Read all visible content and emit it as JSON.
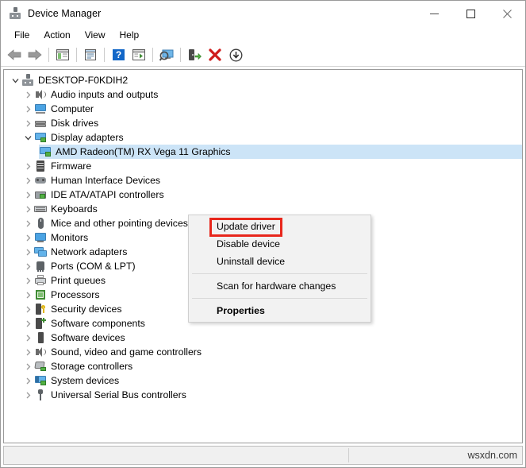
{
  "window": {
    "title": "Device Manager",
    "icon": "device-manager-icon",
    "controls": {
      "minimize": "minimize-icon",
      "maximize": "maximize-icon",
      "close": "close-icon"
    }
  },
  "menubar": {
    "items": [
      {
        "label": "File"
      },
      {
        "label": "Action"
      },
      {
        "label": "View"
      },
      {
        "label": "Help"
      }
    ]
  },
  "toolbar": {
    "buttons": [
      {
        "name": "back-icon",
        "title": "Back"
      },
      {
        "name": "forward-icon",
        "title": "Forward"
      },
      {
        "name": "show-hide-console-tree-icon",
        "title": "Show/Hide console tree"
      },
      {
        "name": "properties-icon",
        "title": "Properties"
      },
      {
        "name": "help-icon",
        "title": "Help"
      },
      {
        "name": "scan-for-hardware-changes-icon",
        "title": "Scan for hardware changes"
      },
      {
        "name": "update-driver-icon",
        "title": "Update driver"
      },
      {
        "name": "uninstall-device-icon",
        "title": "Uninstall device"
      },
      {
        "name": "disable-device-icon",
        "title": "Disable device"
      },
      {
        "name": "enable-device-icon",
        "title": "Enable device"
      }
    ]
  },
  "tree": {
    "root": {
      "label": "DESKTOP-F0KDIH2",
      "icon": "computer-root-icon",
      "expanded": true
    },
    "items": [
      {
        "label": "Audio inputs and outputs",
        "icon": "speaker-icon",
        "expanded": false,
        "level": 1
      },
      {
        "label": "Computer",
        "icon": "computer-icon",
        "expanded": false,
        "level": 1
      },
      {
        "label": "Disk drives",
        "icon": "disk-drive-icon",
        "expanded": false,
        "level": 1
      },
      {
        "label": "Display adapters",
        "icon": "display-adapter-icon",
        "expanded": true,
        "level": 1
      },
      {
        "label": "AMD Radeon(TM) RX Vega 11 Graphics",
        "icon": "display-adapter-icon",
        "expanded": null,
        "level": 2,
        "selected": true
      },
      {
        "label": "Firmware",
        "icon": "firmware-icon",
        "expanded": false,
        "level": 1
      },
      {
        "label": "Human Interface Devices",
        "icon": "hid-icon",
        "expanded": false,
        "level": 1
      },
      {
        "label": "IDE ATA/ATAPI controllers",
        "icon": "ide-controller-icon",
        "expanded": false,
        "level": 1
      },
      {
        "label": "Keyboards",
        "icon": "keyboard-icon",
        "expanded": false,
        "level": 1
      },
      {
        "label": "Mice and other pointing devices",
        "icon": "mouse-icon",
        "expanded": false,
        "level": 1
      },
      {
        "label": "Monitors",
        "icon": "monitor-icon",
        "expanded": false,
        "level": 1
      },
      {
        "label": "Network adapters",
        "icon": "network-adapter-icon",
        "expanded": false,
        "level": 1
      },
      {
        "label": "Ports (COM & LPT)",
        "icon": "port-icon",
        "expanded": false,
        "level": 1
      },
      {
        "label": "Print queues",
        "icon": "printer-icon",
        "expanded": false,
        "level": 1
      },
      {
        "label": "Processors",
        "icon": "processor-icon",
        "expanded": false,
        "level": 1
      },
      {
        "label": "Security devices",
        "icon": "security-device-icon",
        "expanded": false,
        "level": 1
      },
      {
        "label": "Software components",
        "icon": "software-component-icon",
        "expanded": false,
        "level": 1
      },
      {
        "label": "Software devices",
        "icon": "software-device-icon",
        "expanded": false,
        "level": 1
      },
      {
        "label": "Sound, video and game controllers",
        "icon": "speaker-icon",
        "expanded": false,
        "level": 1
      },
      {
        "label": "Storage controllers",
        "icon": "storage-controller-icon",
        "expanded": false,
        "level": 1
      },
      {
        "label": "System devices",
        "icon": "system-device-icon",
        "expanded": false,
        "level": 1
      },
      {
        "label": "Universal Serial Bus controllers",
        "icon": "usb-controller-icon",
        "expanded": false,
        "level": 1
      }
    ]
  },
  "context_menu": {
    "items": [
      {
        "label": "Update driver",
        "bold": false,
        "highlighted": true
      },
      {
        "label": "Disable device",
        "bold": false,
        "highlighted": false
      },
      {
        "label": "Uninstall device",
        "bold": false,
        "highlighted": false
      },
      {
        "separator": true
      },
      {
        "label": "Scan for hardware changes",
        "bold": false,
        "highlighted": false
      },
      {
        "separator": true
      },
      {
        "label": "Properties",
        "bold": true,
        "highlighted": false
      }
    ],
    "highlight_color": "#e8271c"
  },
  "statusbar": {
    "text": "",
    "watermark": "wsxdn.com"
  }
}
